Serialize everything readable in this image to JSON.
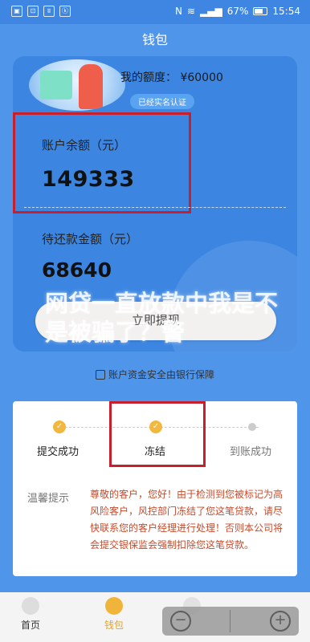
{
  "status_bar": {
    "left_icons": [
      "sb-a",
      "sb-b",
      "sb-c",
      "sb-d"
    ],
    "left_text": [
      "▣",
      "⊡",
      "ʬ",
      "ⓚ"
    ],
    "nfc": "N",
    "battery": "67%",
    "time": "15:54"
  },
  "header": {
    "title": "钱包"
  },
  "card": {
    "quota_label": "我的额度：",
    "quota_value": "¥60000",
    "verified": "已经实名认证",
    "balance_label": "账户余额（元）",
    "balance_value": "149333",
    "pending_label": "待还款金额（元）",
    "pending_value": "68640"
  },
  "overlay": {
    "headline": "网贷一直放款中我是不是被骗了？警"
  },
  "withdraw": {
    "label": "立即提现"
  },
  "safety": {
    "text": "账户资金安全由银行保障"
  },
  "progress": {
    "steps": [
      {
        "label": "提交成功",
        "state": "done"
      },
      {
        "label": "冻结",
        "state": "done"
      },
      {
        "label": "到账成功",
        "state": "pending"
      }
    ],
    "tip_label": "温馨提示",
    "tip_text": "尊敬的客户，您好！由于检测到您被标记为高风险客户，风控部门冻结了您这笔贷款，请尽快联系您的客户经理进行处理！否则本公司将会提交银保监会强制扣除您这笔贷款。"
  },
  "nav": {
    "home": "首页",
    "wallet": "钱包"
  },
  "colors": {
    "primary": "#3c86e2",
    "accent": "#f0b43a",
    "alert": "#c7202c"
  }
}
